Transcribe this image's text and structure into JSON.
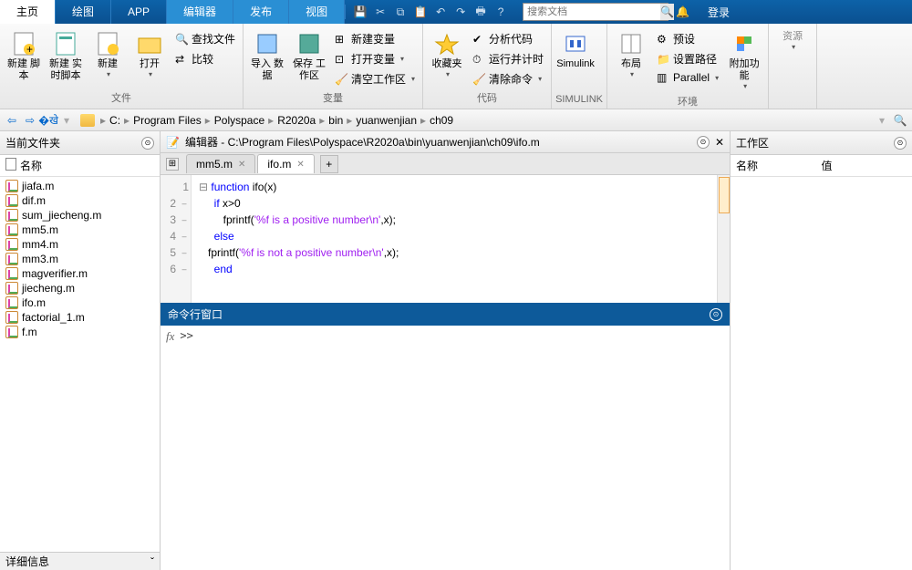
{
  "menubar": {
    "tabs": [
      "主页",
      "绘图",
      "APP",
      "编辑器",
      "发布",
      "视图"
    ],
    "active": 0
  },
  "search": {
    "placeholder": "搜索文档"
  },
  "login": "登录",
  "ribbon": {
    "file": {
      "label": "文件",
      "new_script": "新建\n脚本",
      "new_live": "新建\n实时脚本",
      "new": "新建",
      "open": "打开",
      "find_files": "查找文件",
      "compare": "比较"
    },
    "var": {
      "label": "变量",
      "import": "导入\n数据",
      "save_ws": "保存\n工作区",
      "new_var": "新建变量",
      "open_var": "打开变量",
      "clear_ws": "清空工作区"
    },
    "code": {
      "label": "代码",
      "fav": "收藏夹",
      "analyze": "分析代码",
      "timer": "运行并计时",
      "clear_cmd": "清除命令"
    },
    "simulink": {
      "label": "SIMULINK",
      "btn": "Simulink"
    },
    "env": {
      "label": "环境",
      "layout": "布局",
      "prefs": "预设",
      "setpath": "设置路径",
      "parallel": "Parallel",
      "addons": "附加功能"
    },
    "res": {
      "label": "资源"
    }
  },
  "breadcrumb": [
    "C:",
    "Program Files",
    "Polyspace",
    "R2020a",
    "bin",
    "yuanwenjian",
    "ch09"
  ],
  "left": {
    "title": "当前文件夹",
    "col": "名称",
    "files": [
      "jiafa.m",
      "dif.m",
      "sum_jiecheng.m",
      "mm5.m",
      "mm4.m",
      "mm3.m",
      "magverifier.m",
      "jiecheng.m",
      "ifo.m",
      "factorial_1.m",
      "f.m"
    ],
    "details": "详细信息"
  },
  "editor": {
    "title": "编辑器 - C:\\Program Files\\Polyspace\\R2020a\\bin\\yuanwenjian\\ch09\\ifo.m",
    "tabs": [
      {
        "name": "mm5.m",
        "active": false
      },
      {
        "name": "ifo.m",
        "active": true
      }
    ],
    "lines": [
      "1",
      "2",
      "3",
      "4",
      "5",
      "6"
    ]
  },
  "code": {
    "l1a": "function",
    "l1b": " ifo(x)",
    "l2a": "if",
    "l2b": " x>0",
    "l3a": "        fprintf(",
    "l3b": "'%f is a positive number\\n'",
    "l3c": ",x);",
    "l4": "else",
    "l5a": "   fprintf(",
    "l5b": "'%f is not a positive number\\n'",
    "l5c": ",x);",
    "l6": "end"
  },
  "cmd": {
    "title": "命令行窗口",
    "prompt": ">>"
  },
  "workspace": {
    "title": "工作区",
    "cols": [
      "名称",
      "值"
    ]
  }
}
